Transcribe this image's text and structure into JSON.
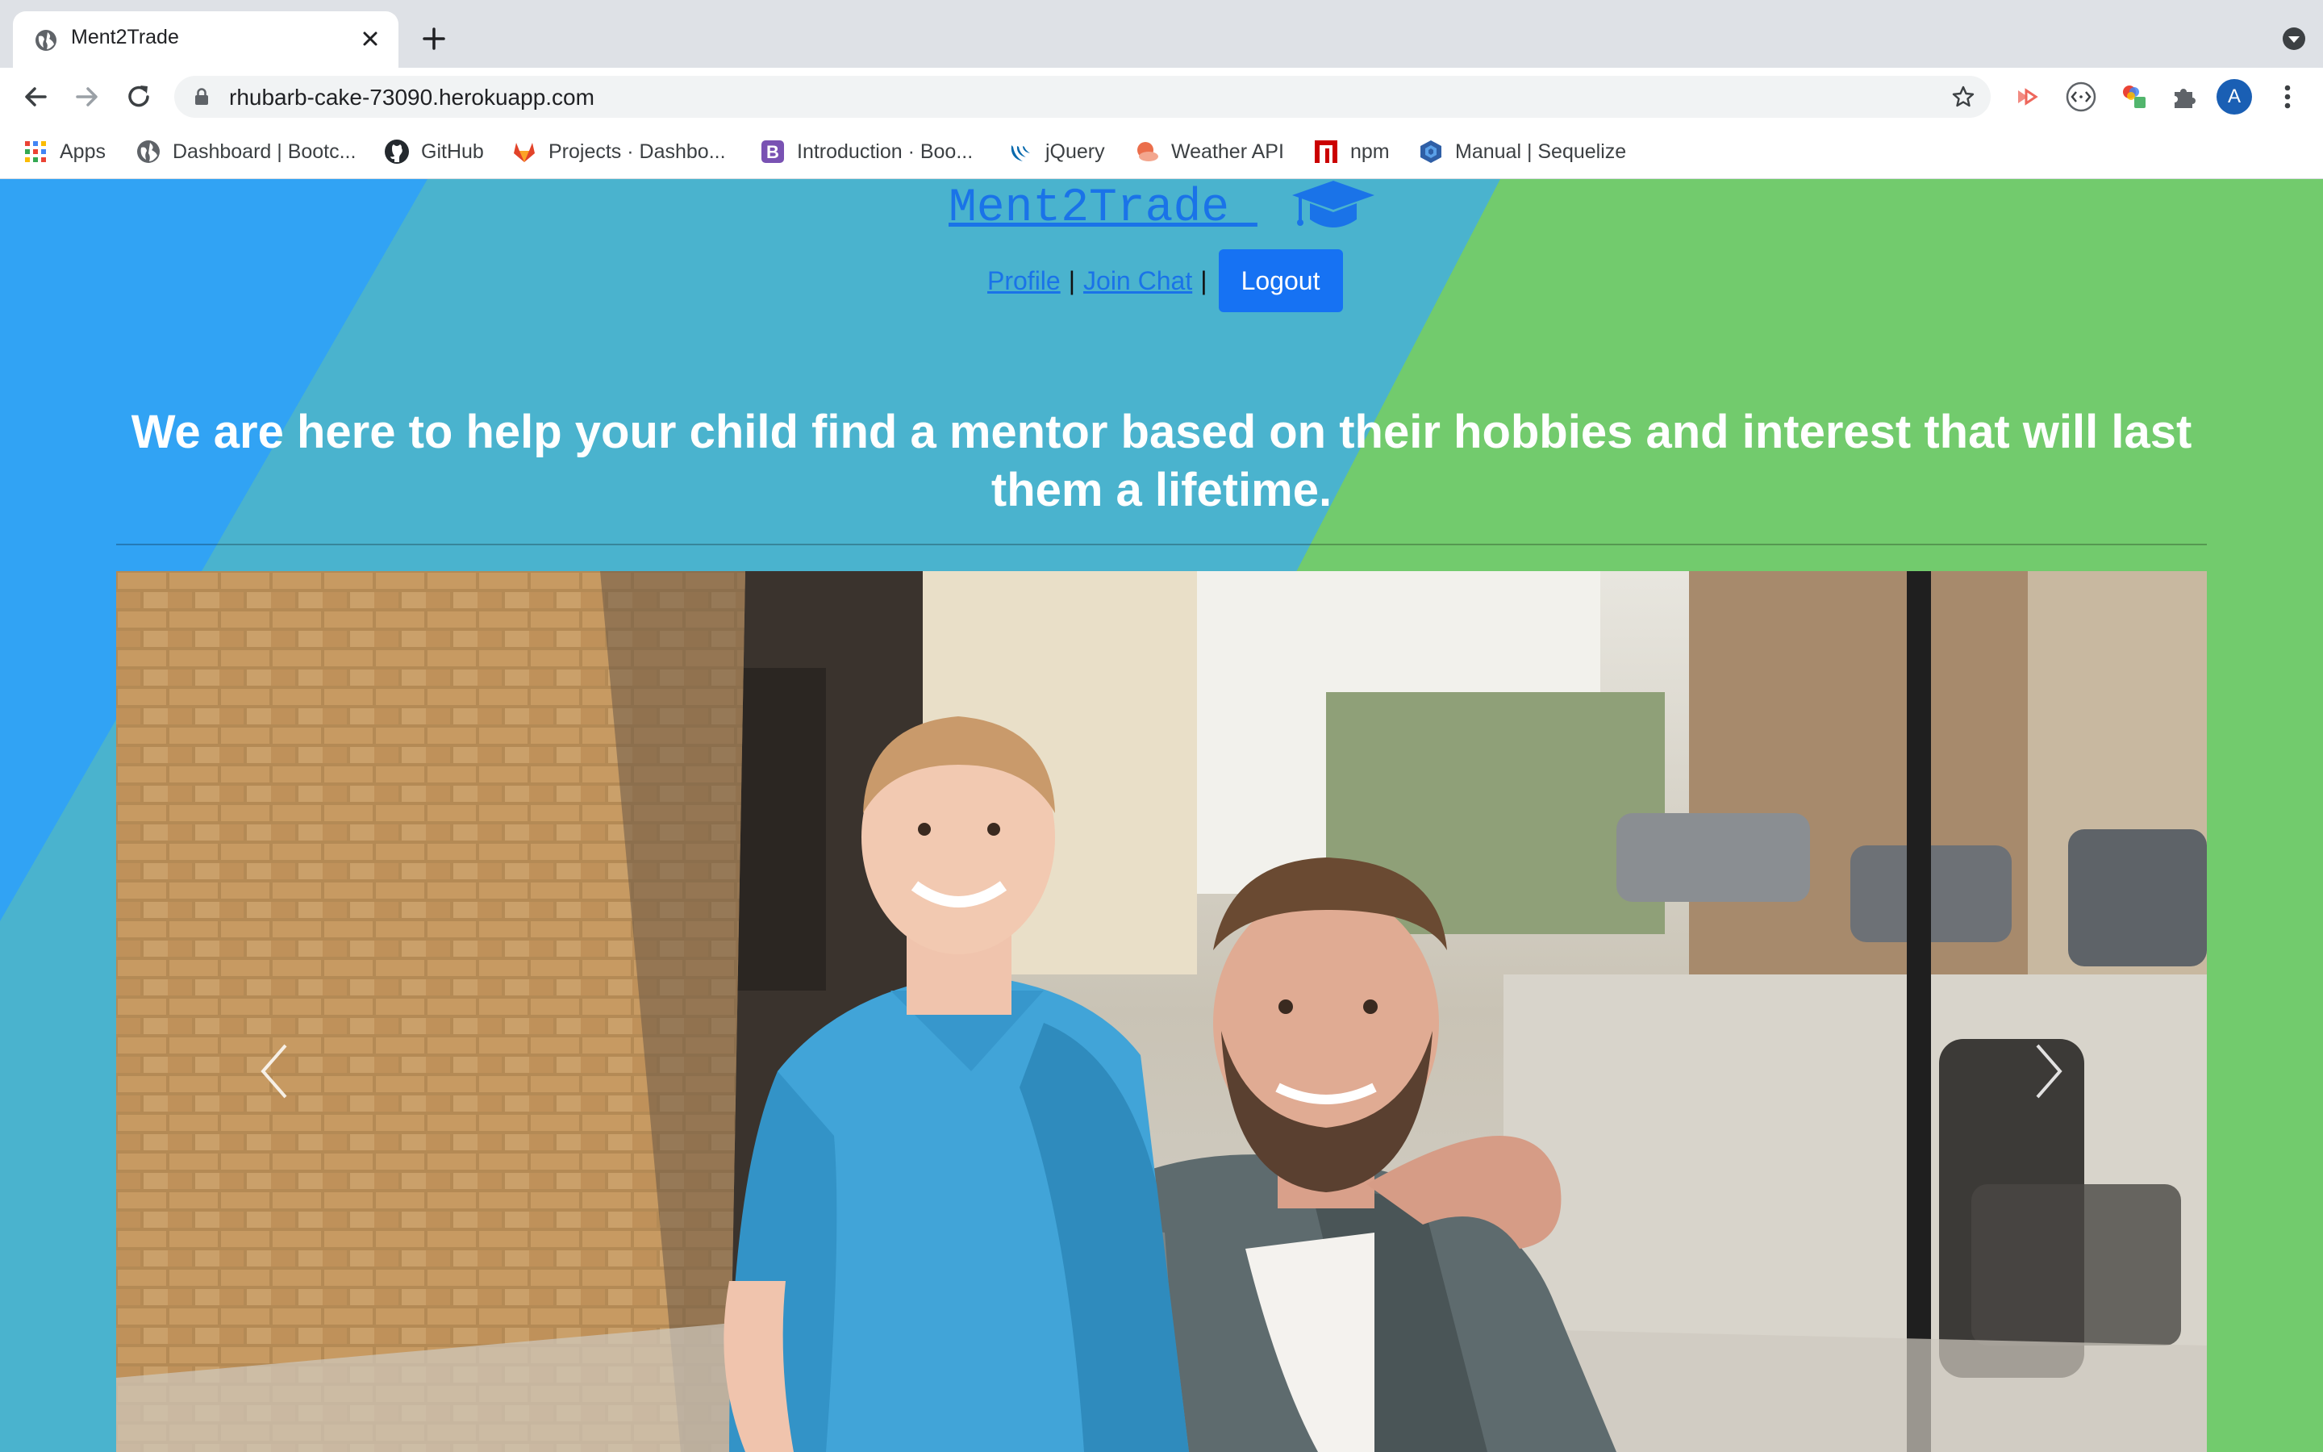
{
  "browser": {
    "tab_title": "Ment2Trade",
    "url": "rhubarb-cake-73090.herokuapp.com",
    "profile_initial": "A",
    "bookmarks": [
      {
        "label": "Apps",
        "icon": "apps-grid-icon"
      },
      {
        "label": "Dashboard | Bootc...",
        "icon": "globe-icon"
      },
      {
        "label": "GitHub",
        "icon": "github-icon"
      },
      {
        "label": "Projects · Dashbo...",
        "icon": "gitlab-icon"
      },
      {
        "label": "Introduction · Boo...",
        "icon": "bootstrap-icon"
      },
      {
        "label": "jQuery",
        "icon": "jquery-icon"
      },
      {
        "label": "Weather API",
        "icon": "weather-icon"
      },
      {
        "label": "npm",
        "icon": "npm-icon"
      },
      {
        "label": "Manual | Sequelize",
        "icon": "sequelize-icon"
      }
    ]
  },
  "page": {
    "logo": "Ment2Trade ",
    "nav": {
      "profile": "Profile",
      "separator": "|",
      "join_chat": "Join Chat",
      "logout": "Logout"
    },
    "headline": "We are here to help your child find a mentor based on their hobbies and interest that will last them a lifetime.",
    "carousel": {
      "image": "mentor-and-boy-photo",
      "prev_icon": "chevron-left-icon",
      "next_icon": "chevron-right-icon"
    }
  },
  "colors": {
    "bg_blue": "#31a3f4",
    "bg_teal": "#4ab3ce",
    "bg_green": "#72cb6d",
    "link": "#1a73e8",
    "button": "#1672f3"
  }
}
